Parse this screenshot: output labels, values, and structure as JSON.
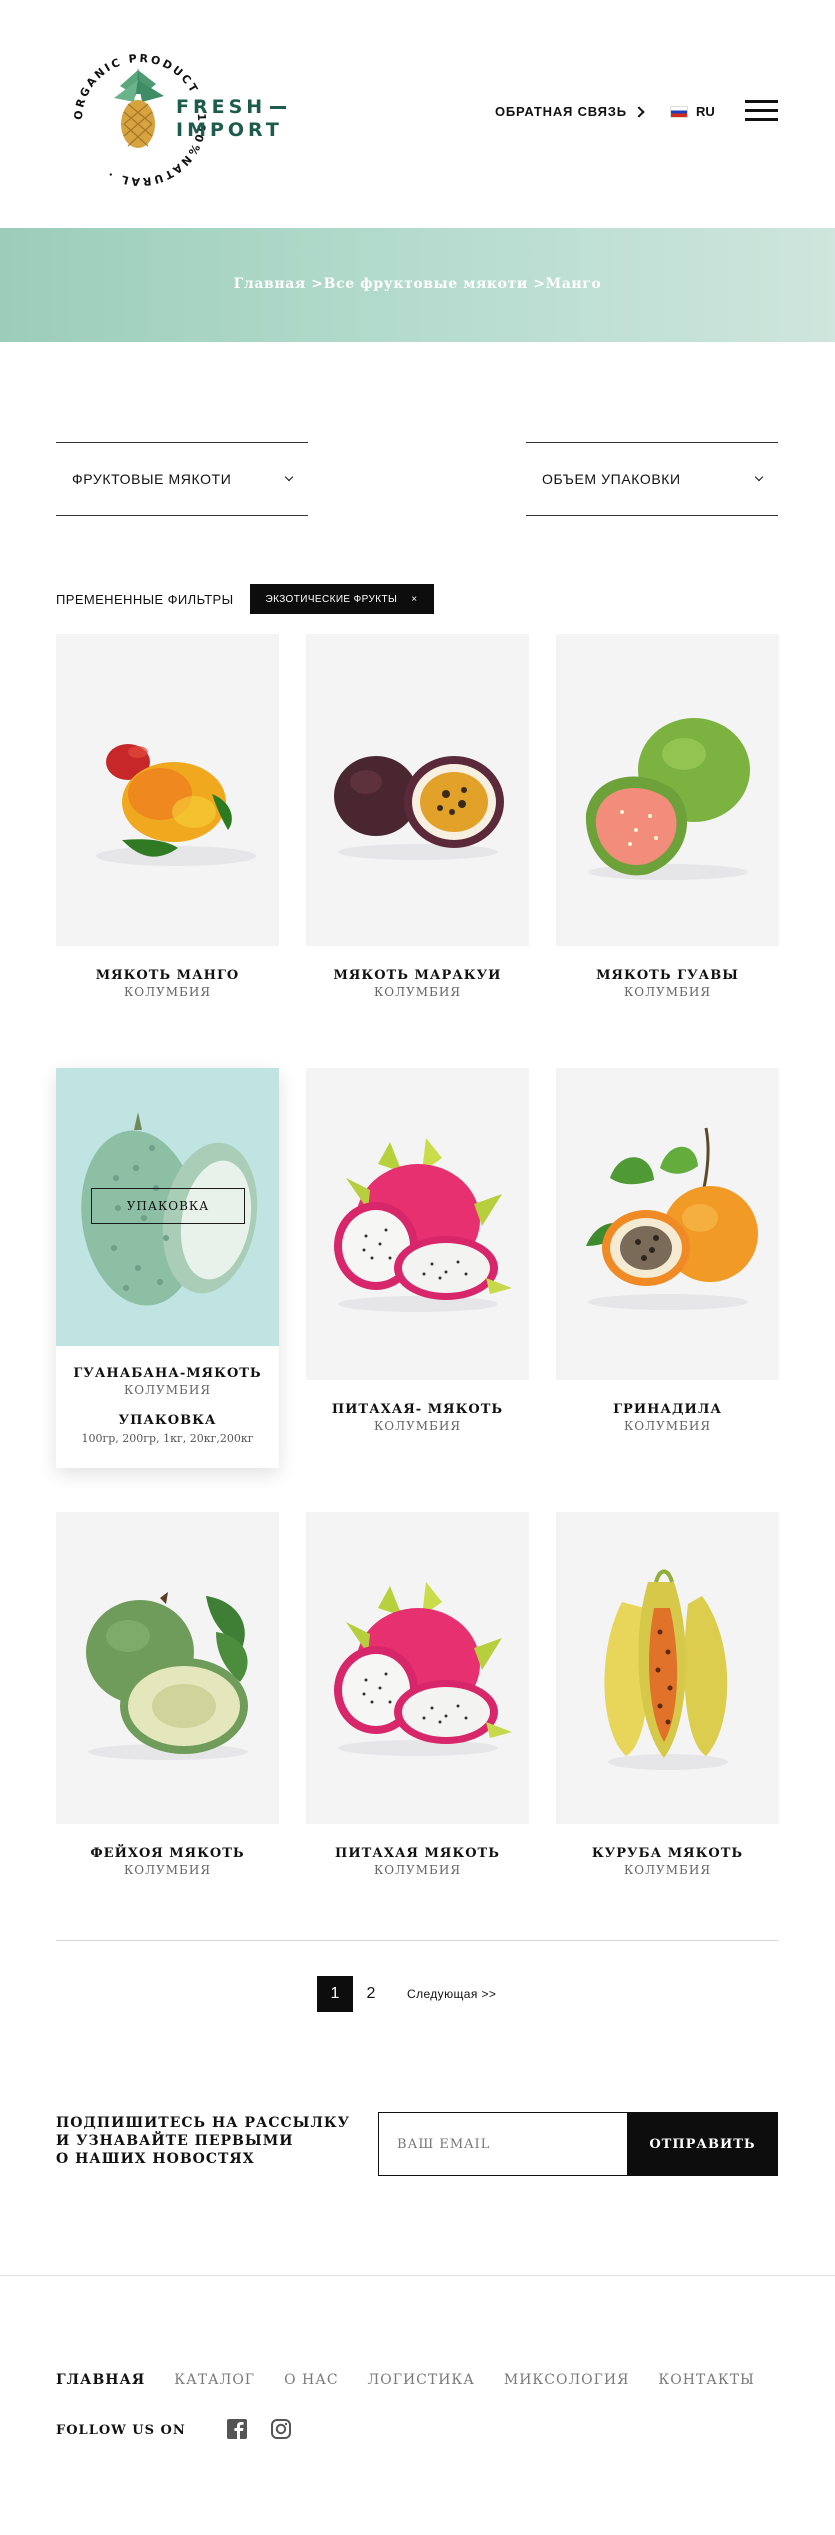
{
  "header": {
    "logo": {
      "ring_text": "ORGANIC PRODUCT · 100%NATURAL ·",
      "line1": "FRESH",
      "line2": "IMPORT"
    },
    "feedback_label": "ОБРАТНАЯ СВЯЗЬ",
    "language": "RU"
  },
  "breadcrumbs": [
    "Главная >",
    "Все фруктовые мякоти >",
    "Манго"
  ],
  "filters": {
    "dropdown1": "ФРУКТОВЫЕ МЯКОТИ",
    "dropdown2": "ОБЪЕМ УПАКОВКИ",
    "applied_label": "ПРЕМЕНЕННЫЕ ФИЛЬТРЫ",
    "applied_chip": "ЭКЗОТИЧЕСКИЕ ФРУКТЫ",
    "chip_close": "×"
  },
  "products": [
    {
      "name": "МЯКОТЬ МАНГО",
      "origin": "КОЛУМБИЯ",
      "fruit": "mango"
    },
    {
      "name": "МЯКОТЬ МАРАКУИ",
      "origin": "КОЛУМБИЯ",
      "fruit": "passion-fruit"
    },
    {
      "name": "МЯКОТЬ ГУАВЫ",
      "origin": "КОЛУМБИЯ",
      "fruit": "guava"
    },
    {
      "name": "ГУАНАБАНА-МЯКОТЬ",
      "origin": "КОЛУМБИЯ",
      "fruit": "soursop",
      "pack_button": "УПАКОВКА",
      "pack_title": "УПАКОВКА",
      "pack_sizes": "100гр, 200гр, 1кг, 20кг,200кг"
    },
    {
      "name": "ПИТАХАЯ- МЯКОТЬ",
      "origin": "КОЛУМБИЯ",
      "fruit": "pitahaya"
    },
    {
      "name": "ГРИНАДИЛА",
      "origin": "КОЛУМБИЯ",
      "fruit": "granadilla"
    },
    {
      "name": "ФЕЙХОЯ МЯКОТЬ",
      "origin": "КОЛУМБИЯ",
      "fruit": "feijoa"
    },
    {
      "name": "ПИТАХАЯ МЯКОТЬ",
      "origin": "КОЛУМБИЯ",
      "fruit": "pitahaya"
    },
    {
      "name": "КУРУБА МЯКОТЬ",
      "origin": "КОЛУМБИЯ",
      "fruit": "curuba"
    }
  ],
  "pagination": {
    "pages": [
      "1",
      "2"
    ],
    "current": "1",
    "next": "Следующая >>"
  },
  "newsletter": {
    "lines": [
      "ПОДПИШИТЕСЬ НА РАССЫЛКУ",
      "И УЗНАВАЙТЕ ПЕРВЫМИ",
      "О НАШИХ НОВОСТЯХ"
    ],
    "email_placeholder": "ВАШ EMAIL",
    "submit": "ОТПРАВИТЬ"
  },
  "footer": {
    "nav": [
      "ГЛАВНАЯ",
      "КАТАЛОГ",
      "О НАС",
      "ЛОГИСТИКА",
      "МИКСОЛОГИЯ",
      "КОНТАКТЫ"
    ],
    "follow": "FOLLOW US ON",
    "social_icons": [
      "facebook-icon",
      "instagram-icon"
    ]
  },
  "colors": {
    "accent": "#1d5b4c",
    "banner": "#a9d5c4",
    "active_card": "#bfe4e2",
    "dark": "#0d0d0d"
  }
}
